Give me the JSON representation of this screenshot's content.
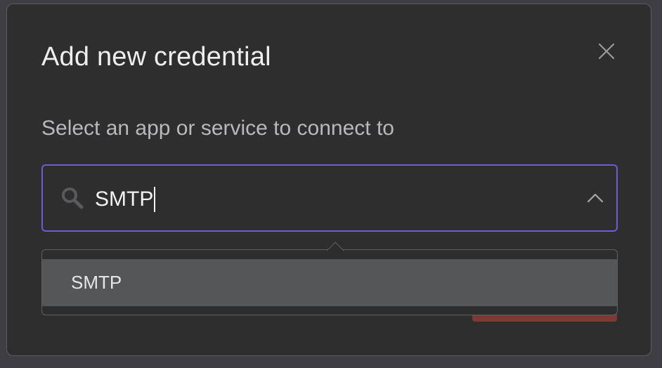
{
  "dialog": {
    "title": "Add new credential",
    "subtitle": "Select an app or service to connect to",
    "search": {
      "value": "SMTP"
    },
    "dropdown": {
      "options": [
        {
          "label": "SMTP"
        }
      ]
    }
  },
  "colors": {
    "background": "#3f3e44",
    "modal": "#2e2e2e",
    "focus_border": "#6e5bd6",
    "option_highlight": "#555657",
    "primary_button_partial": "#7a3b34"
  },
  "icons": {
    "close": "close-icon",
    "search": "search-icon",
    "toggle": "chevron-up-icon"
  }
}
